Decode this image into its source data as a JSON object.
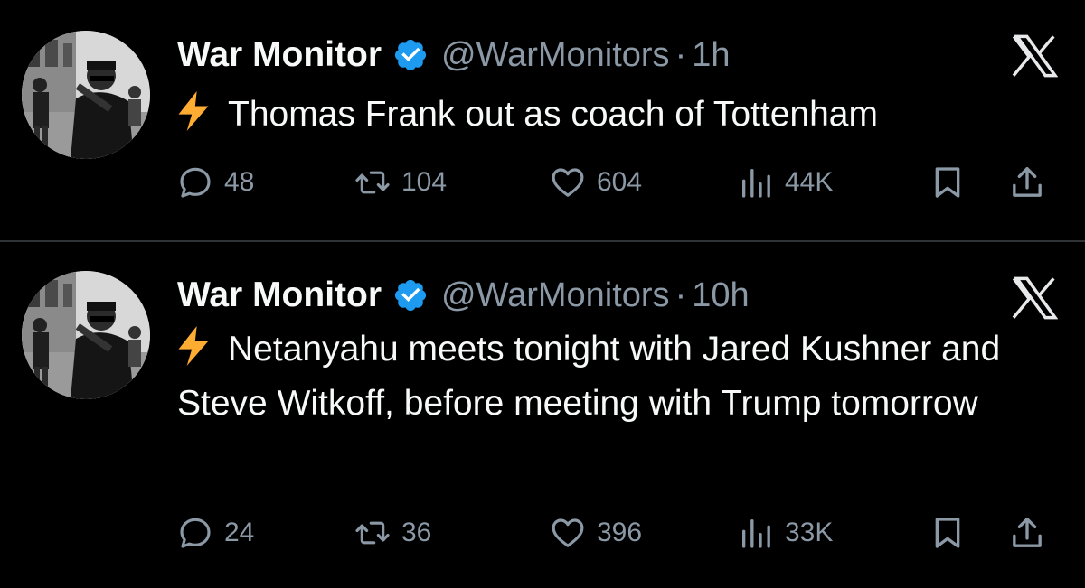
{
  "tweets": [
    {
      "display_name": "War Monitor",
      "handle": "@WarMonitors",
      "separator": "·",
      "time": "1h",
      "text": "Thomas Frank out as coach of Tottenham",
      "replies": "48",
      "reposts": "104",
      "likes": "604",
      "views": "44K"
    },
    {
      "display_name": "War Monitor",
      "handle": "@WarMonitors",
      "separator": "·",
      "time": "10h",
      "text": "Netanyahu meets tonight with Jared Kushner and Steve Witkoff, before meeting with Trump tomorrow",
      "replies": "24",
      "reposts": "36",
      "likes": "396",
      "views": "33K"
    }
  ],
  "icons": {
    "verified": "verified-badge-icon",
    "x_logo": "x-logo-icon",
    "bolt": "lightning-bolt-icon",
    "reply": "reply-icon",
    "repost": "repost-icon",
    "like": "heart-icon",
    "views": "views-chart-icon",
    "bookmark": "bookmark-icon",
    "share": "share-icon"
  },
  "colors": {
    "background": "#000000",
    "text": "#f7f9f9",
    "muted": "#8b98a5",
    "verified_blue": "#1d9bf0",
    "bolt_yellow": "#ffac33",
    "divider": "#2f3336"
  }
}
